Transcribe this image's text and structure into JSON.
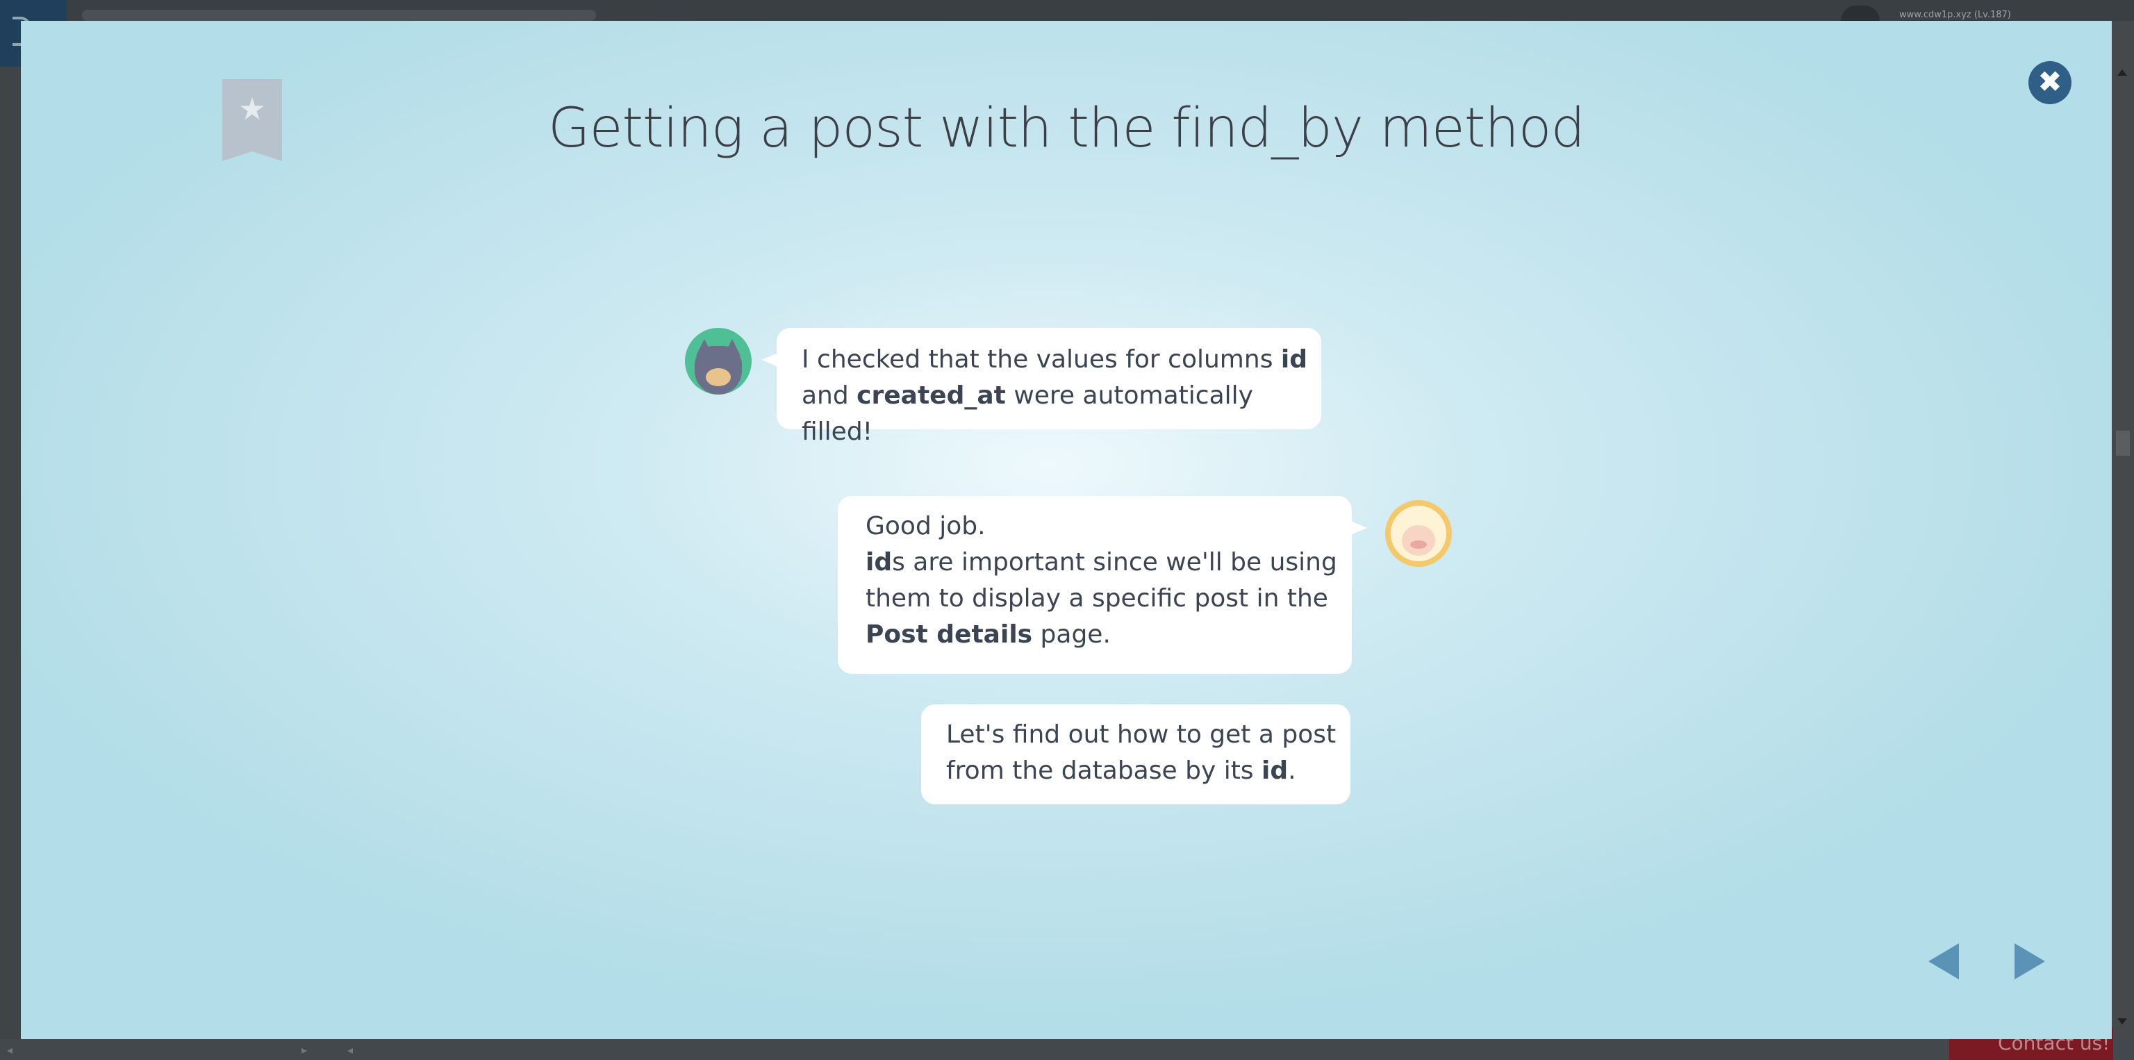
{
  "background": {
    "username": "www.cdw1p.xyz (Lv.187)",
    "contact_label": "Contact us!"
  },
  "modal": {
    "title": "Getting a post with the find_by method",
    "messages": [
      {
        "speaker": "cat",
        "parts": [
          {
            "text": "I checked that the values for columns ",
            "bold": false
          },
          {
            "text": "id",
            "bold": true
          },
          {
            "text": "\nand ",
            "bold": false
          },
          {
            "text": "created_at",
            "bold": true
          },
          {
            "text": " were automatically filled!",
            "bold": false
          }
        ]
      },
      {
        "speaker": "sheep",
        "parts": [
          {
            "text": "Good job.\n",
            "bold": false
          },
          {
            "text": "id",
            "bold": true
          },
          {
            "text": "s are important since we'll be using\nthem to display a specific post in the\n",
            "bold": false
          },
          {
            "text": "Post details",
            "bold": true
          },
          {
            "text": " page.",
            "bold": false
          }
        ]
      },
      {
        "speaker": "sheep",
        "parts": [
          {
            "text": "Let's find out how to get a post\nfrom the database by its ",
            "bold": false
          },
          {
            "text": "id",
            "bold": true
          },
          {
            "text": ".",
            "bold": false
          }
        ]
      }
    ],
    "close_symbol": "✖",
    "bookmark_symbol": "★"
  },
  "icons": {
    "close": "close-icon",
    "bookmark": "bookmark-icon",
    "prev": "prev-arrow-icon",
    "next": "next-arrow-icon"
  },
  "colors": {
    "accent": "#2f5f87",
    "nav_arrow": "#5b93b7",
    "contact_bg": "#7c1a24"
  }
}
